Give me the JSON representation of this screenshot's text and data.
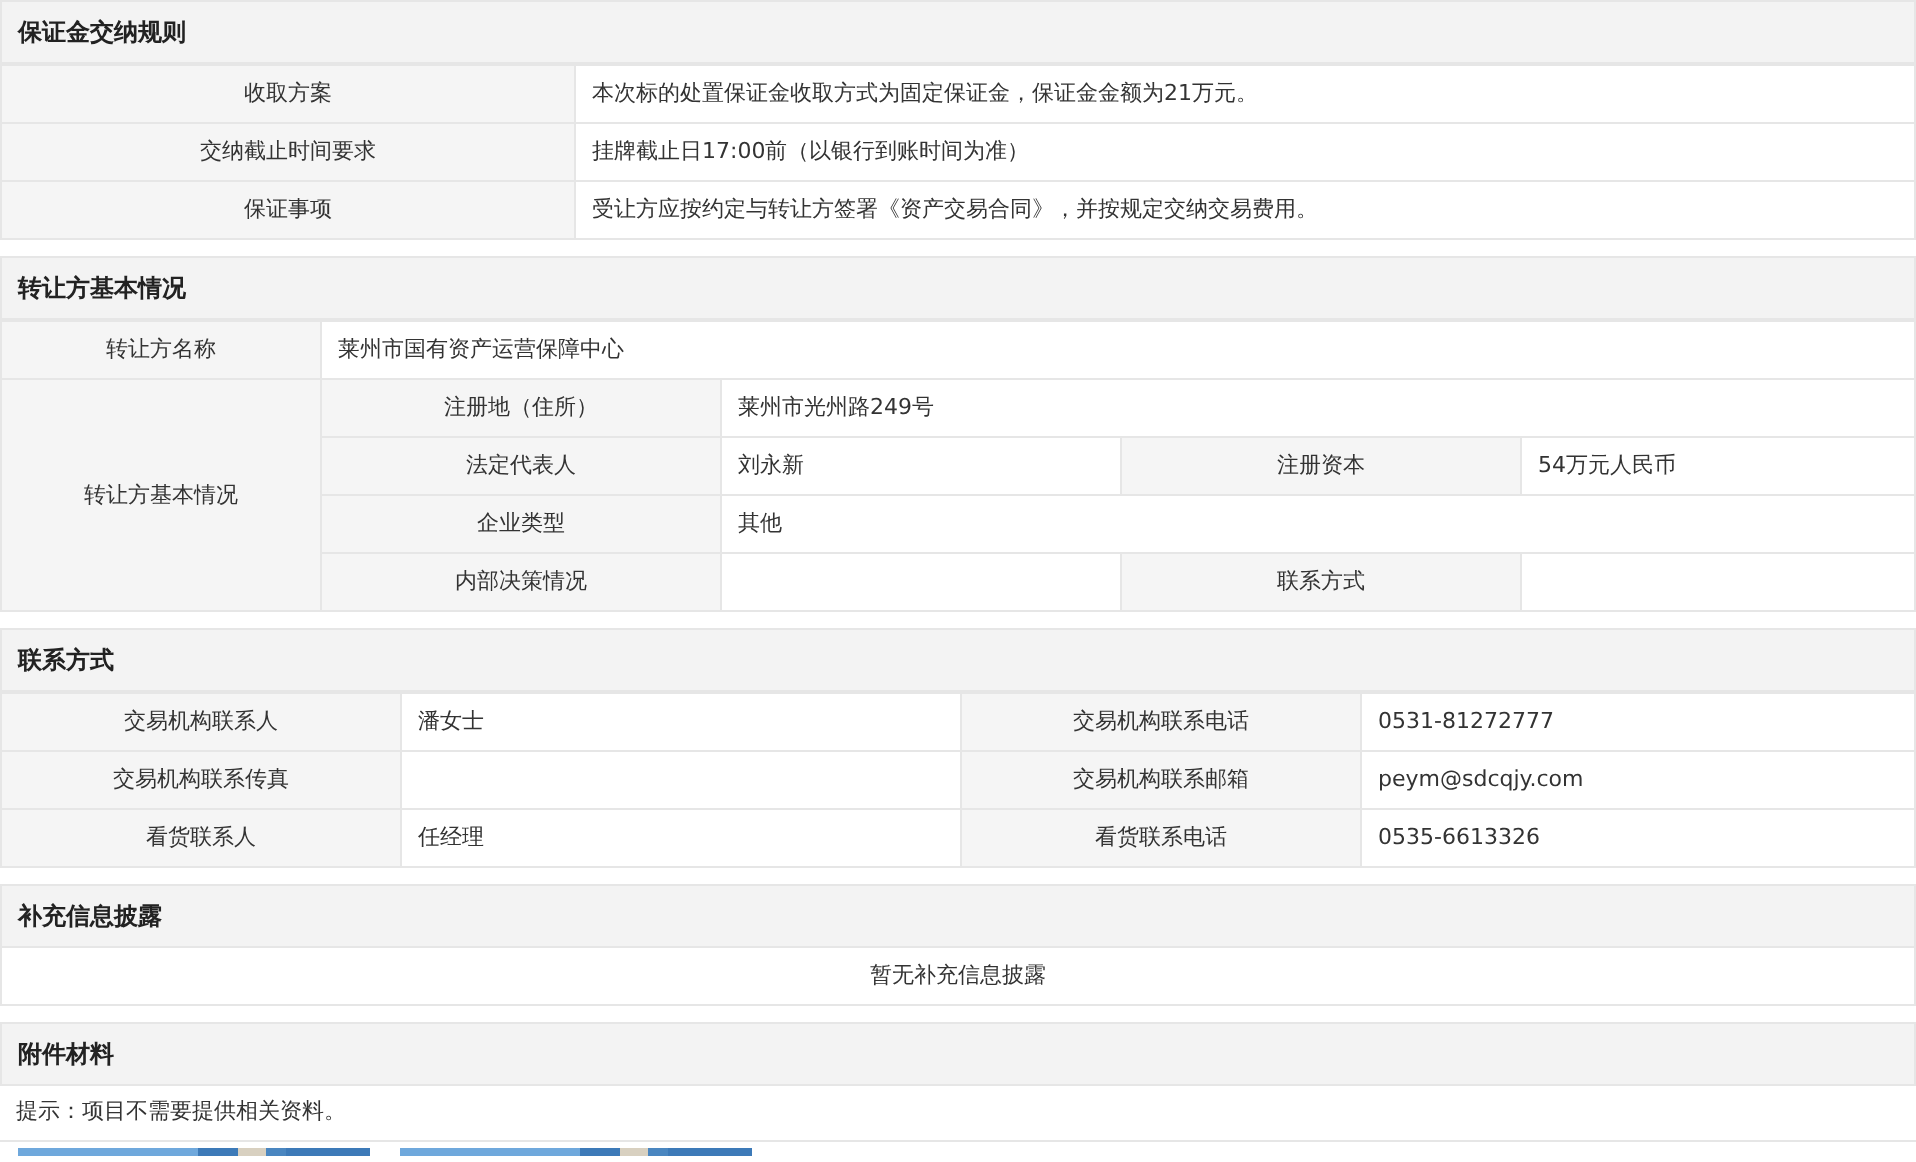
{
  "sections": [
    {
      "kind": "rules",
      "title": "保证金交纳规则",
      "rows": [
        {
          "label": "收取方案",
          "value": "本次标的处置保证金收取方式为固定保证金，保证金金额为21万元。"
        },
        {
          "label": "交纳截止时间要求",
          "value": "挂牌截止日17:00前（以银行到账时间为准）"
        },
        {
          "label": "保证事项",
          "value": "受让方应按约定与转让方签署《资产交易合同》，并按规定交纳交易费用。"
        }
      ]
    },
    {
      "kind": "transferor",
      "title": "转让方基本情况",
      "name_label": "转让方名称",
      "name_value": "莱州市国有资产运营保障中心",
      "group_label": "转让方基本情况",
      "rows": [
        {
          "fields": [
            {
              "label": "注册地（住所）",
              "value": "莱州市光州路249号"
            }
          ]
        },
        {
          "fields": [
            {
              "label": "法定代表人",
              "value": "刘永新"
            },
            {
              "label": "注册资本",
              "value": "54万元人民币"
            }
          ]
        },
        {
          "fields": [
            {
              "label": "企业类型",
              "value": "其他"
            }
          ]
        },
        {
          "fields": [
            {
              "label": "内部决策情况"
            },
            {
              "label": "联系方式"
            }
          ]
        }
      ]
    },
    {
      "kind": "contact",
      "title": "联系方式",
      "rows": [
        {
          "cells": [
            "交易机构联系人",
            "潘女士",
            "交易机构联系电话",
            "0531-81272777"
          ]
        },
        {
          "cells": [
            "交易机构联系传真",
            "",
            "交易机构联系邮箱",
            "peym@sdcqjy.com"
          ]
        },
        {
          "cells": [
            "看货联系人",
            "任经理",
            "看货联系电话",
            "0535-6613326"
          ]
        }
      ]
    },
    {
      "kind": "notice",
      "title": "补充信息披露",
      "text": "暂无补充信息披露"
    },
    {
      "kind": "attachments",
      "title": "附件材料",
      "text": "提示：项目不需要提供相关资料。"
    }
  ]
}
